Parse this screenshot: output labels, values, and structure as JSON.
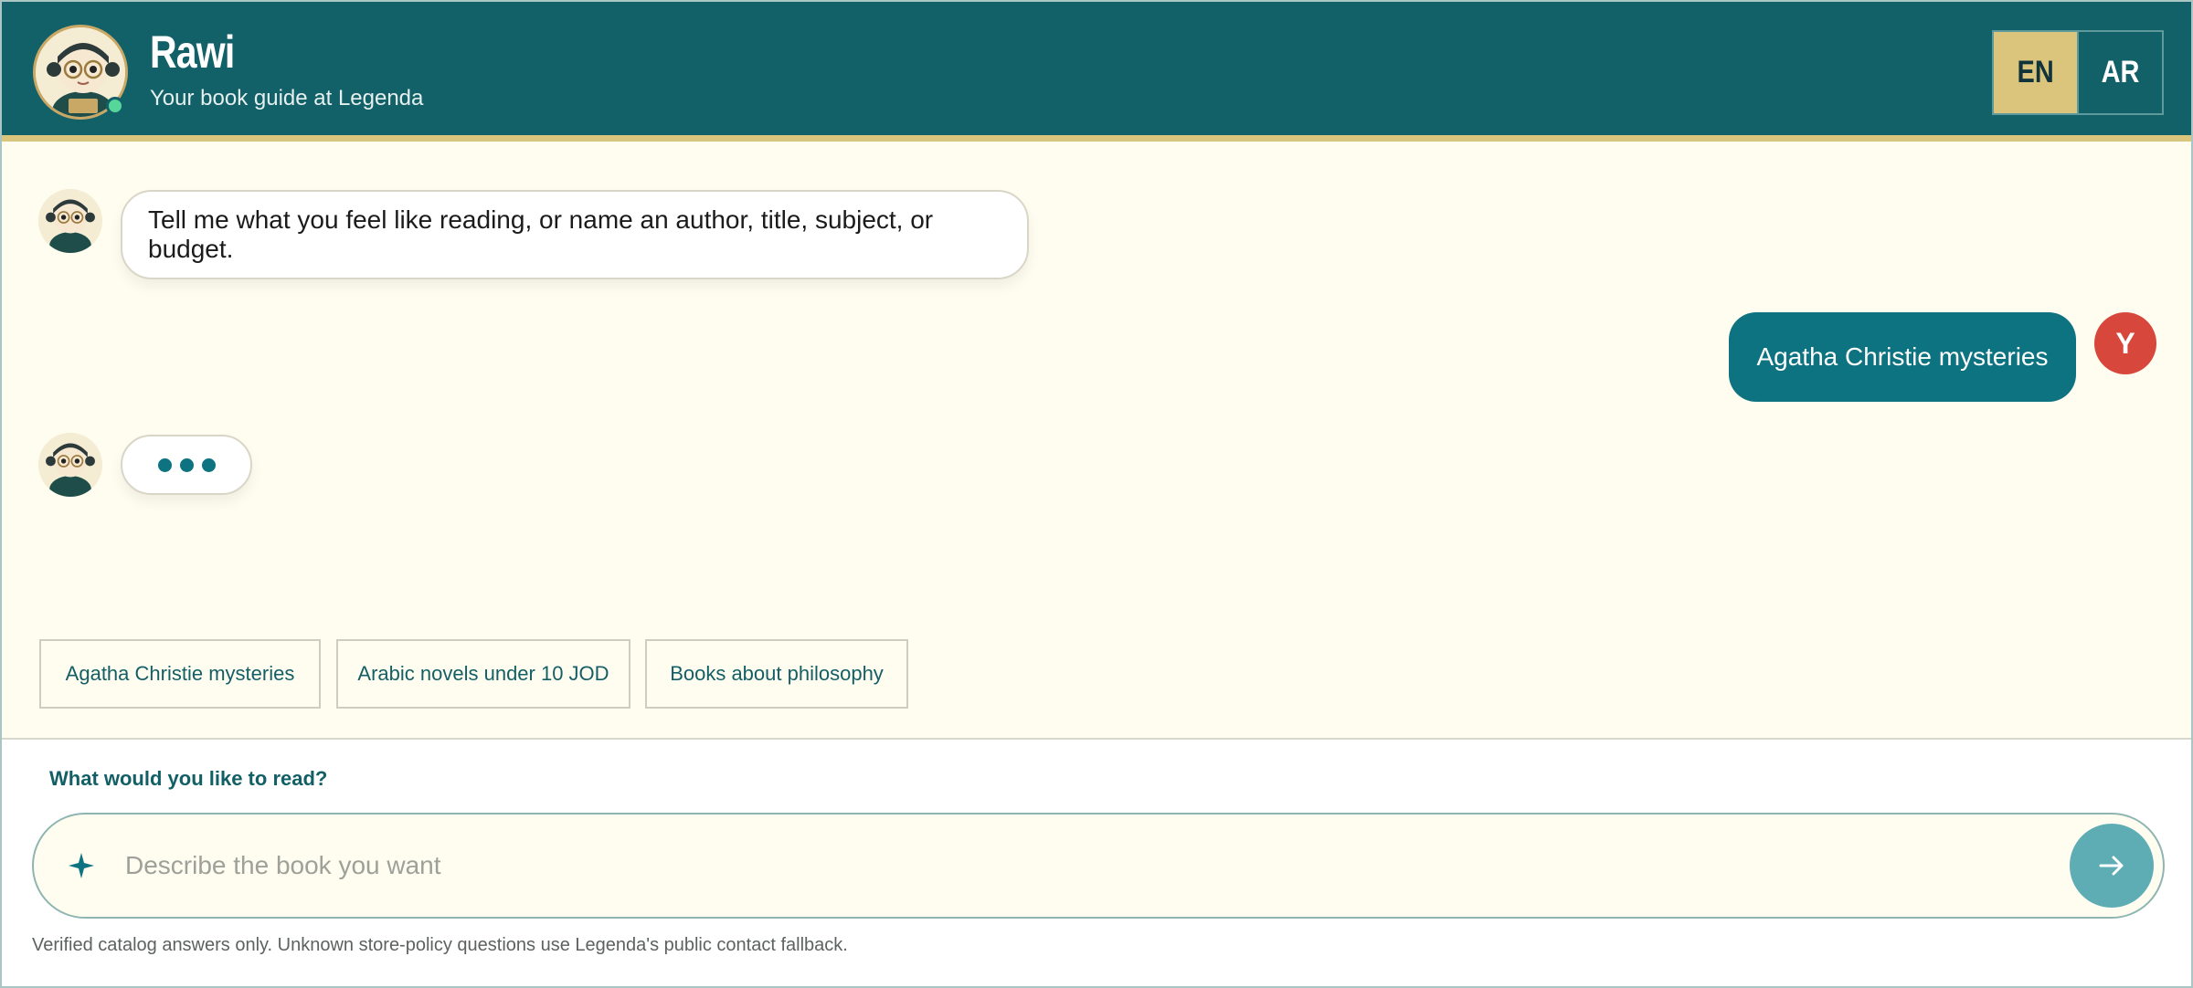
{
  "header": {
    "title": "Rawi",
    "subtitle": "Your book guide at Legenda",
    "languages": [
      {
        "label": "EN",
        "active": true
      },
      {
        "label": "AR",
        "active": false
      }
    ]
  },
  "chat": {
    "messages": [
      {
        "role": "assistant",
        "text": "Tell me what you feel like reading, or name an author, title, subject, or budget."
      },
      {
        "role": "user",
        "text": "Agatha Christie mysteries",
        "avatar_initial": "Y"
      }
    ],
    "typing_indicator": true
  },
  "suggestions": [
    "Agatha Christie mysteries",
    "Arabic novels under 10 JOD",
    "Books about philosophy"
  ],
  "composer": {
    "label": "What would you like to read?",
    "placeholder": "Describe the book you want",
    "value": "",
    "footnote": "Verified catalog answers only. Unknown store-policy questions use Legenda's public contact fallback."
  },
  "icons": {
    "composer_icon": "sparkle-icon",
    "send_icon": "arrow-right-icon"
  },
  "colors": {
    "header_bg": "#126068",
    "accent_gold": "#dbc47c",
    "user_bubble": "#0e7381",
    "user_avatar": "#d8473b",
    "send_button": "#5eadb5",
    "online_status": "#57d69a"
  }
}
